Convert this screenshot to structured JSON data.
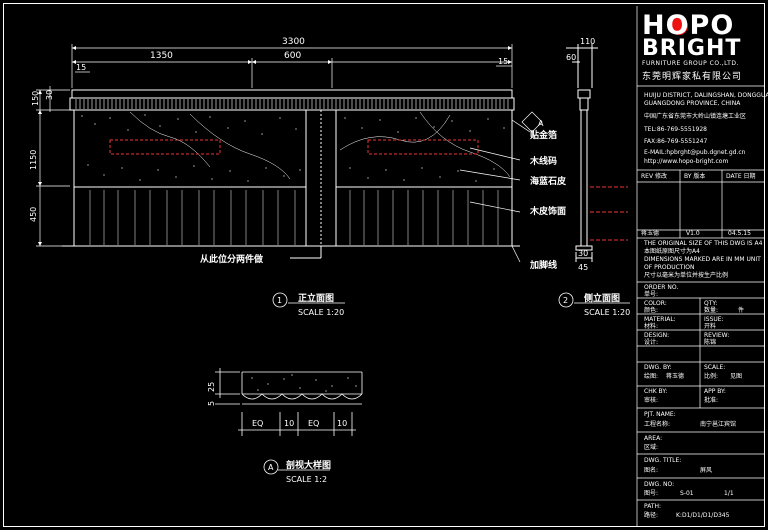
{
  "drawing": {
    "overall_width": "3300",
    "dim_1350": "1350",
    "dim_600": "600",
    "dim_15_left": "15",
    "dim_15_right": "15",
    "dim_150": "150",
    "dim_30": "30",
    "dim_1150": "1150",
    "dim_450": "450",
    "side_dim_110": "110",
    "side_dim_60": "60",
    "side_dim_30": "30",
    "side_dim_45": "45",
    "detail_dim_25": "25",
    "detail_dim_5": "5",
    "detail_dims": [
      "EQ",
      "10",
      "EQ",
      "10"
    ],
    "callout_a": "A",
    "labels": {
      "mitered_gold": "贴金箔",
      "wood_line": "木线码",
      "marble": "海蓝石皮",
      "wood_veneer": "木皮饰面",
      "kick": "加脚线",
      "split_note": "从此位分两件做"
    },
    "views": [
      {
        "num": "1",
        "title": "正立面图",
        "scale": "SCALE 1:20"
      },
      {
        "num": "2",
        "title": "侧立面图",
        "scale": "SCALE 1:20"
      },
      {
        "num": "A",
        "title": "剖视大样图",
        "scale": "SCALE 1:2"
      }
    ]
  },
  "titleblock": {
    "logo_line1": "HOPO",
    "logo_line2": "BRIGHT",
    "logo_sub": "FURNITURE GROUP CO.,LTD.",
    "logo_cn": "东莞明辉家私有限公司",
    "address_lines": [
      "HUIJU DISTRICT, DALINGSHAN, DONGGUAN",
      "GUANGDONG PROVINCE, CHINA",
      "中国广东省东莞市大岭山镇连塘工业区",
      "TEL:86-769-5551928",
      "FAX:86-769-5551247",
      "E-MAIL:hpbrght@pub.dgnet.gd.cn",
      "http://www.hopo-bright.com"
    ],
    "rev_header": [
      "REV 修改",
      "BY 版本",
      "DATE 日期"
    ],
    "rev_row": [
      "蒋玉德",
      "V1.0",
      "04.5.15"
    ],
    "notes": [
      "THE ORIGINAL SIZE OF THIS DWG IS A4",
      "本图纸原图尺寸为A4",
      "DIMENSIONS MARKED ARE IN MM UNIT",
      "OF PRODUCTION",
      "尺寸以毫米为单位并按生产比例"
    ],
    "fields": [
      {
        "en": "ORDER NO.",
        "cn": "单号:"
      },
      {
        "en": "COLOR:",
        "cn": "颜色:",
        "en2": "QTY:",
        "cn2": "数量:",
        "val2": "件"
      },
      {
        "en": "MATERIAL:",
        "cn": "材料:",
        "en2": "ISSUE:",
        "cn2": "",
        "val2": "开料"
      },
      {
        "en": "DESIGN:",
        "cn": "设计:",
        "en2": "REVIEW:",
        "cn2": "",
        "val2": "陈锦"
      },
      {
        "en": "DWG. BY:",
        "cn": "绘图:",
        "val": "蒋玉德",
        "en2": "SCALE:",
        "cn2": "比例:",
        "val2": "见图"
      },
      {
        "en": "CHK BY:",
        "cn": "审核:",
        "en2": "APP BY:",
        "cn2": "批准:"
      },
      {
        "en": "PJT. NAME:",
        "cn": "工程名称:",
        "val": "南宁邕江宾馆"
      },
      {
        "en": "AREA:",
        "cn": "区域:"
      },
      {
        "en": "DWG. TITLE:",
        "cn": "图名:",
        "val": "屏风"
      },
      {
        "en": "DWG. NO:",
        "cn": "图号:",
        "val": "S-01",
        "val2": "1/1"
      },
      {
        "en": "PATH:",
        "cn": "路径:",
        "val": "K:D1/D1/D1/D345"
      }
    ]
  }
}
